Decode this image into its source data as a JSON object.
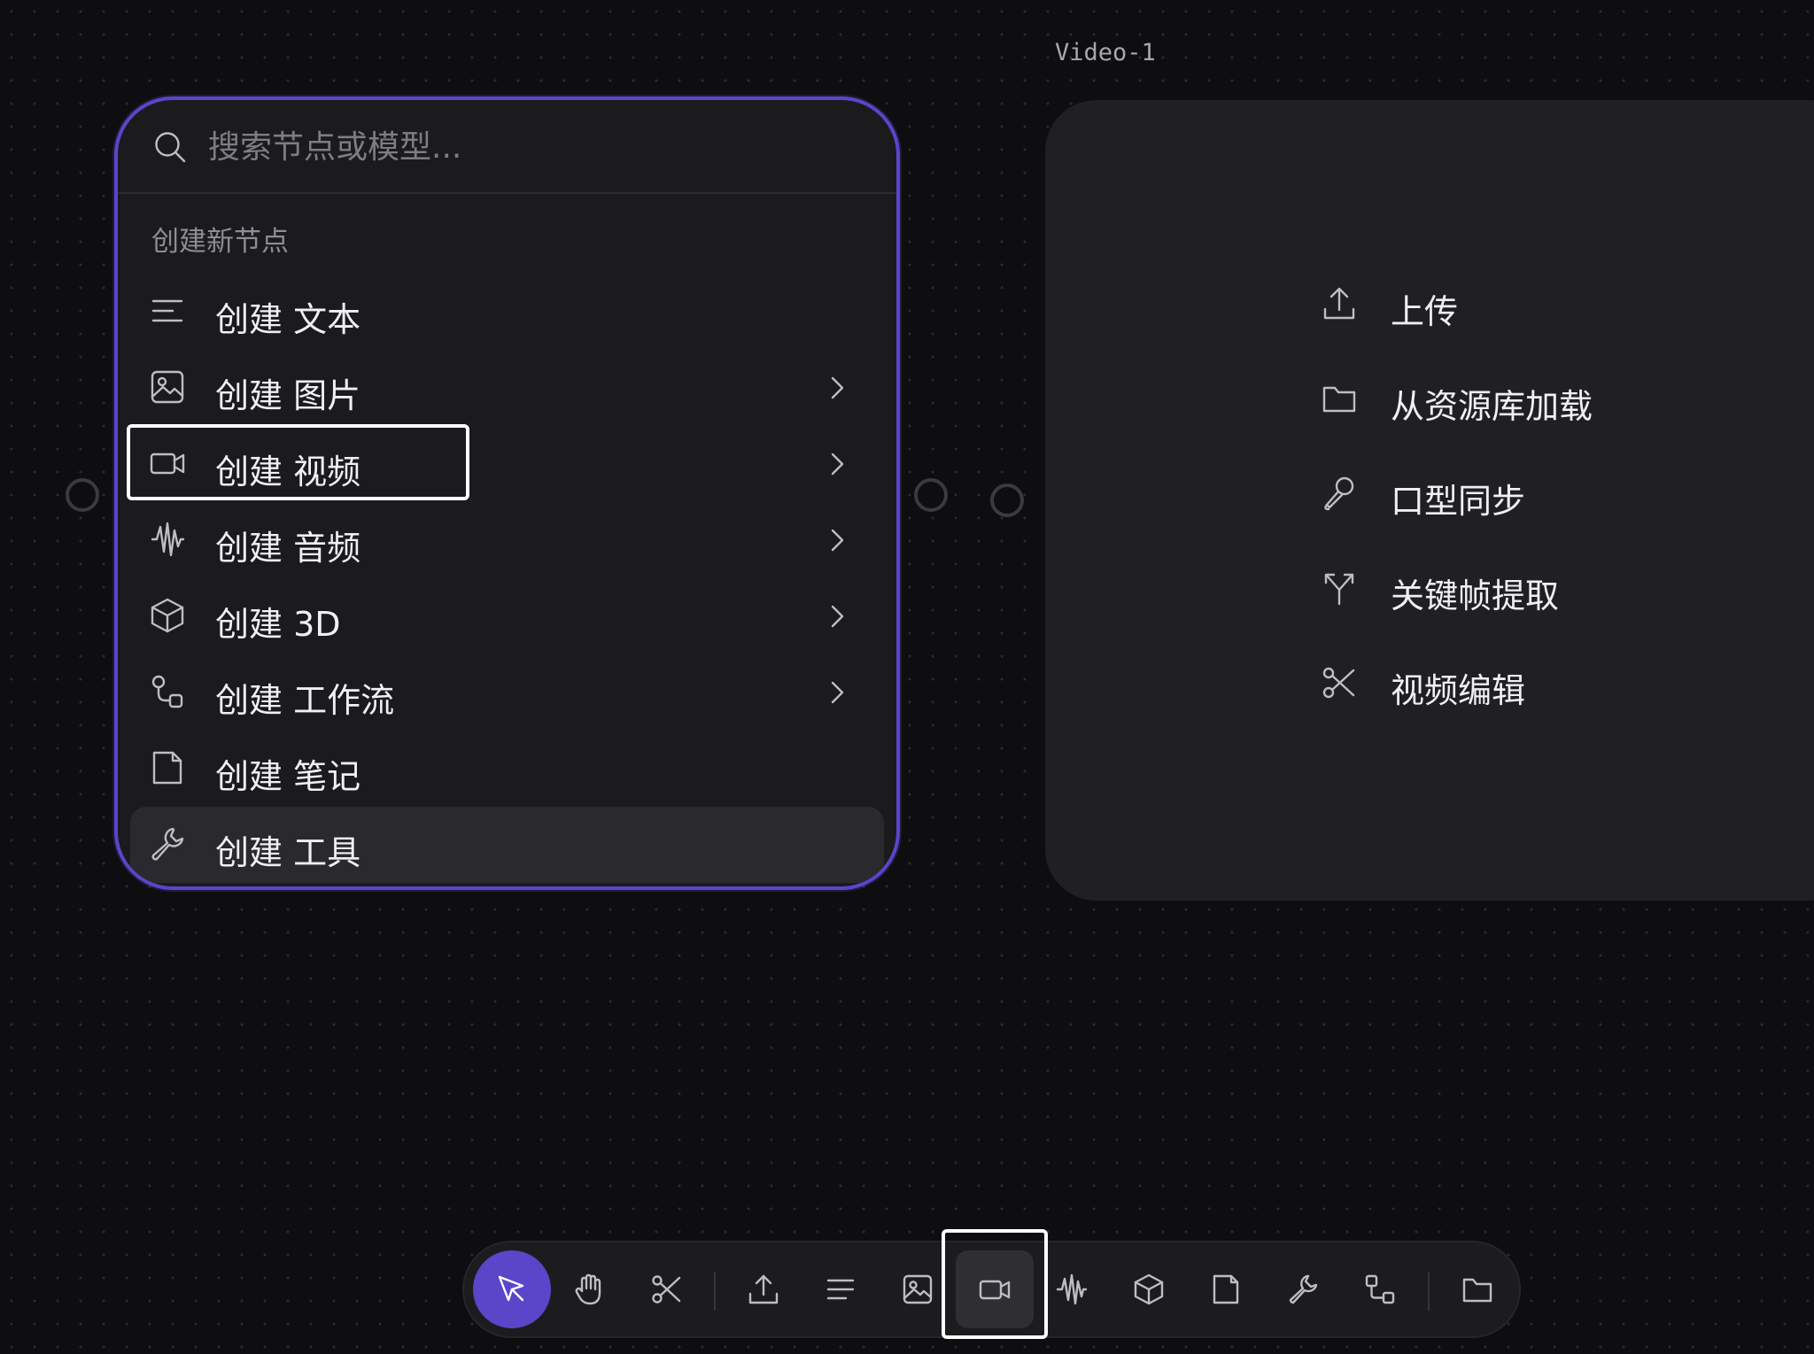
{
  "canvas": {
    "node_title": "Video-1"
  },
  "menu": {
    "search_placeholder": "搜索节点或模型...",
    "section_label": "创建新节点",
    "items": [
      {
        "label": "创建 文本",
        "icon": "text-lines-icon",
        "has_submenu": false
      },
      {
        "label": "创建 图片",
        "icon": "image-icon",
        "has_submenu": true
      },
      {
        "label": "创建 视频",
        "icon": "video-camera-icon",
        "has_submenu": true,
        "highlighted": true
      },
      {
        "label": "创建 音频",
        "icon": "audio-wave-icon",
        "has_submenu": true
      },
      {
        "label": "创建 3D",
        "icon": "cube-icon",
        "has_submenu": true
      },
      {
        "label": "创建 工作流",
        "icon": "workflow-icon",
        "has_submenu": true
      },
      {
        "label": "创建 笔记",
        "icon": "note-icon",
        "has_submenu": false
      },
      {
        "label": "创建 工具",
        "icon": "wrench-icon",
        "has_submenu": false,
        "hovered": true
      }
    ]
  },
  "video_node": {
    "actions": [
      {
        "label": "上传",
        "icon": "upload-icon"
      },
      {
        "label": "从资源库加载",
        "icon": "folder-icon"
      },
      {
        "label": "口型同步",
        "icon": "microphone-icon"
      },
      {
        "label": "关键帧提取",
        "icon": "split-arrows-icon"
      },
      {
        "label": "视频编辑",
        "icon": "scissors-icon"
      }
    ]
  },
  "toolbar": {
    "tools": [
      {
        "name": "select",
        "icon": "cursor-icon",
        "state": "active"
      },
      {
        "name": "pan",
        "icon": "hand-icon"
      },
      {
        "name": "cut",
        "icon": "scissors-icon"
      },
      {
        "name": "upload",
        "icon": "upload-icon"
      },
      {
        "name": "text",
        "icon": "text-lines-icon"
      },
      {
        "name": "image",
        "icon": "image-icon"
      },
      {
        "name": "video",
        "icon": "video-camera-icon",
        "state": "selected"
      },
      {
        "name": "audio",
        "icon": "audio-wave-icon"
      },
      {
        "name": "3d",
        "icon": "cube-icon"
      },
      {
        "name": "note",
        "icon": "note-icon"
      },
      {
        "name": "tool",
        "icon": "wrench-icon"
      },
      {
        "name": "workflow",
        "icon": "workflow-icon"
      },
      {
        "name": "assets",
        "icon": "folder-icon"
      }
    ]
  },
  "colors": {
    "accent": "#5b45c9",
    "background": "#0e0e10",
    "panel": "#1b1b1e",
    "node": "#202023"
  }
}
